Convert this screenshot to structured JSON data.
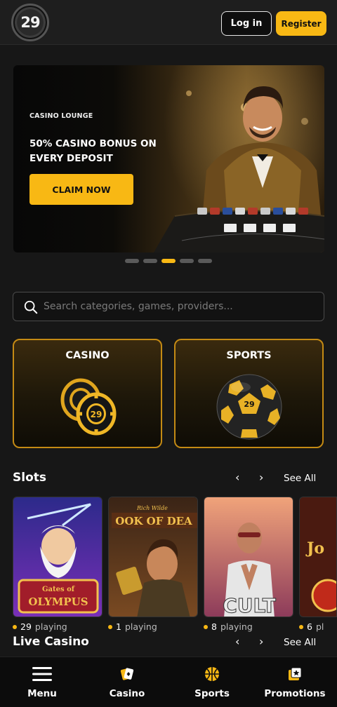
{
  "header": {
    "logo_text": "29",
    "login_label": "Log in",
    "register_label": "Register"
  },
  "banner": {
    "eyebrow": "CASINO LOUNGE",
    "title": "50% CASINO BONUS ON EVERY DEPOSIT",
    "cta_label": "CLAIM NOW",
    "slides_total": 5,
    "active_slide": 3
  },
  "search": {
    "placeholder": "Search categories, games, providers..."
  },
  "categories": [
    {
      "label": "CASINO",
      "icon": "casino-chips-icon"
    },
    {
      "label": "SPORTS",
      "icon": "soccer-ball-icon"
    }
  ],
  "slots": {
    "title": "Slots",
    "see_all_label": "See All",
    "prev_icon": "‹",
    "next_icon": "›",
    "games": [
      {
        "name": "Gates of Olympus",
        "players": "29",
        "suffix": "playing"
      },
      {
        "name": "Book of Dead",
        "players": "1",
        "suffix": "playing"
      },
      {
        "name": "Cult",
        "players": "8",
        "suffix": "playing"
      },
      {
        "name": "Joker",
        "players": "6",
        "suffix": "pl"
      }
    ]
  },
  "live_casino": {
    "title": "Live Casino",
    "see_all_label": "See All",
    "prev_icon": "‹",
    "next_icon": "›"
  },
  "bottom_nav": [
    {
      "label": "Menu",
      "icon": "hamburger-menu-icon"
    },
    {
      "label": "Casino",
      "icon": "casino-cards-icon"
    },
    {
      "label": "Sports",
      "icon": "basketball-icon"
    },
    {
      "label": "Promotions",
      "icon": "promotions-icon"
    }
  ],
  "colors": {
    "accent": "#f8b814",
    "background": "#171717",
    "header": "#1e1e1e",
    "card_border": "#c48a14"
  }
}
